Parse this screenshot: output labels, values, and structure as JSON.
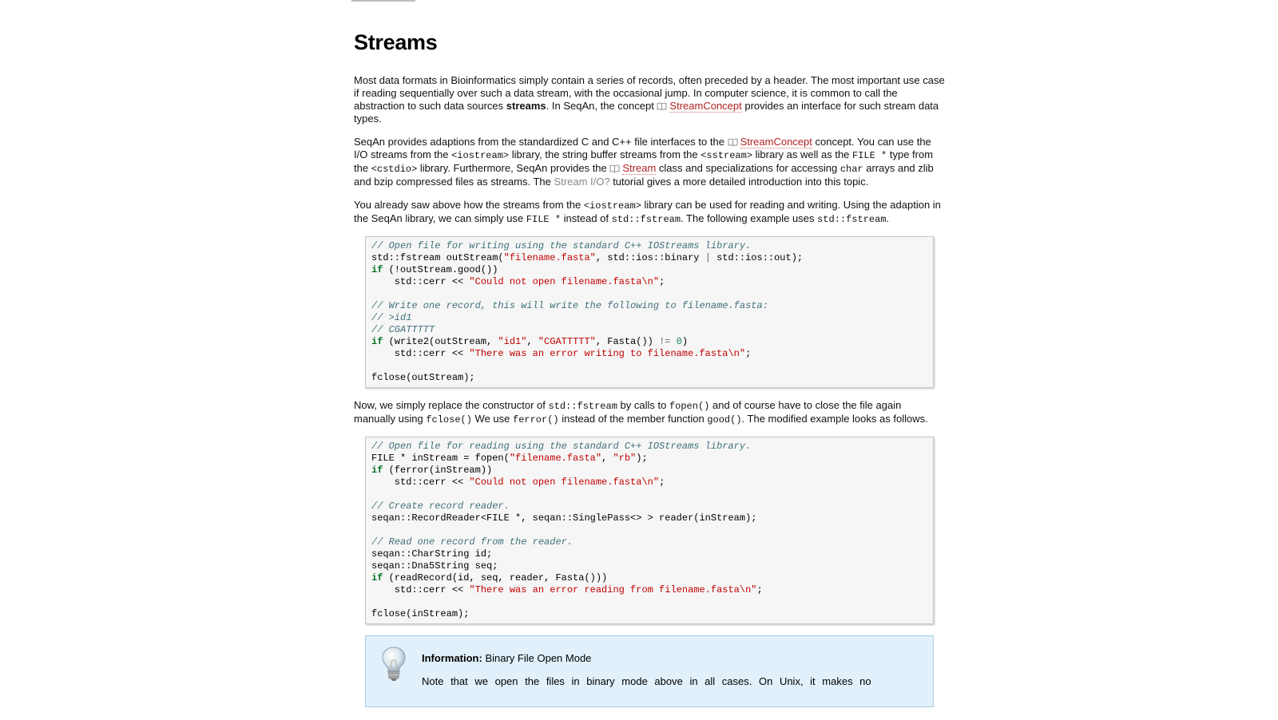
{
  "page": {
    "title": "Streams"
  },
  "para1": {
    "t1": "Most data formats in Bioinformatics simply contain a series of records, often preceded by a header. The most important use case if reading sequentially over such a data stream, with the occasional jump. In computer science, it is common to call the abstraction to such data sources ",
    "bold": "streams",
    "t2": ". In SeqAn, the concept ",
    "link": "StreamConcept",
    "t3": " provides an interface for such stream data types."
  },
  "para2": {
    "t1": "SeqAn provides adaptions from the standardized C and C++ file interfaces to the ",
    "link1": "StreamConcept",
    "t2": " concept. You can use the I/O streams from the ",
    "code1": "<iostream>",
    "t3": " library, the string buffer streams from the ",
    "code2": "<sstream>",
    "t4": " library as well as the ",
    "code3": "FILE *",
    "t5": " type from the ",
    "code4": "<cstdio>",
    "t6": " library. Furthermore, SeqAn provides the ",
    "link2": "Stream",
    "t7": " class and specializations for accessing ",
    "code5": "char",
    "t8": " arrays and zlib and bzip compressed files as streams. The ",
    "link3": "Stream I/O?",
    "t9": " tutorial gives a more detailed introduction into this topic."
  },
  "para3": {
    "t1": "You already saw above how the streams from the ",
    "code1": "<iostream>",
    "t2": " library can be used for reading and writing. Using the adaption in the SeqAn library, we can simply use ",
    "code2": "FILE *",
    "t3": " instead of ",
    "code3": "std::fstream",
    "t4": ". The following example uses ",
    "code4": "std::fstream",
    "t5": "."
  },
  "code1": {
    "l1": "// Open file for writing using the standard C++ IOStreams library.",
    "l2a": "std::fstream outStream(",
    "l2s": "\"filename.fasta\"",
    "l2b": ", std::ios::binary ",
    "l2op": "|",
    "l2c": " std::ios::out);",
    "l3kw": "if",
    "l3": " (!outStream.good())",
    "l4a": "    std::cerr << ",
    "l4s": "\"Could not open filename.fasta\\n\"",
    "l4b": ";",
    "l6": "// Write one record, this will write the following to filename.fasta:",
    "l7": "// >id1",
    "l8": "// CGATTTTT",
    "l9kw": "if",
    "l9a": " (write2(outStream, ",
    "l9s1": "\"id1\"",
    "l9b": ", ",
    "l9s2": "\"CGATTTTT\"",
    "l9c": ", Fasta()) ",
    "l9op": "!=",
    "l9num": " 0",
    "l9d": ")",
    "l10a": "    std::cerr << ",
    "l10s": "\"There was an error writing to filename.fasta\\n\"",
    "l10b": ";",
    "l12": "fclose(outStream);"
  },
  "para4": {
    "t1": "Now, we simply replace the constructor of ",
    "code1": "std::fstream",
    "t2": " by calls to ",
    "code2": "fopen()",
    "t3": " and of course have to close the file again manually using ",
    "code3": "fclose()",
    "t4": " We use ",
    "code4": "ferror()",
    "t5": " instead of the member function ",
    "code5": "good()",
    "t6": ". The modified example looks as follows."
  },
  "code2": {
    "l1": "// Open file for reading using the standard C++ IOStreams library.",
    "l2a": "FILE * inStream = fopen(",
    "l2s1": "\"filename.fasta\"",
    "l2b": ", ",
    "l2s2": "\"rb\"",
    "l2c": ");",
    "l3kw": "if",
    "l3": " (ferror(inStream))",
    "l4a": "    std::cerr << ",
    "l4s": "\"Could not open filename.fasta\\n\"",
    "l4b": ";",
    "l6": "// Create record reader.",
    "l7": "seqan::RecordReader<FILE *, seqan::SinglePass<> > reader(inStream);",
    "l9": "// Read one record from the reader.",
    "l10": "seqan::CharString id;",
    "l11": "seqan::Dna5String seq;",
    "l12kw": "if",
    "l12": " (readRecord(id, seq, reader, Fasta()))",
    "l13a": "    std::cerr << ",
    "l13s": "\"There was an error reading from filename.fasta\\n\"",
    "l13b": ";",
    "l15": "fclose(inStream);"
  },
  "info": {
    "label": "Information:",
    "title": "Binary File Open Mode",
    "text": "Note that we open the files in binary mode above in all cases. On Unix, it makes no"
  },
  "icons": {
    "doc": "book-icon",
    "info": "lightbulb-icon"
  },
  "colors": {
    "link": "#b22222",
    "muted_link": "#888888",
    "comment": "#40707a",
    "string": "#c00000",
    "keyword": "#007020",
    "info_bg": "#e1f0fa"
  }
}
